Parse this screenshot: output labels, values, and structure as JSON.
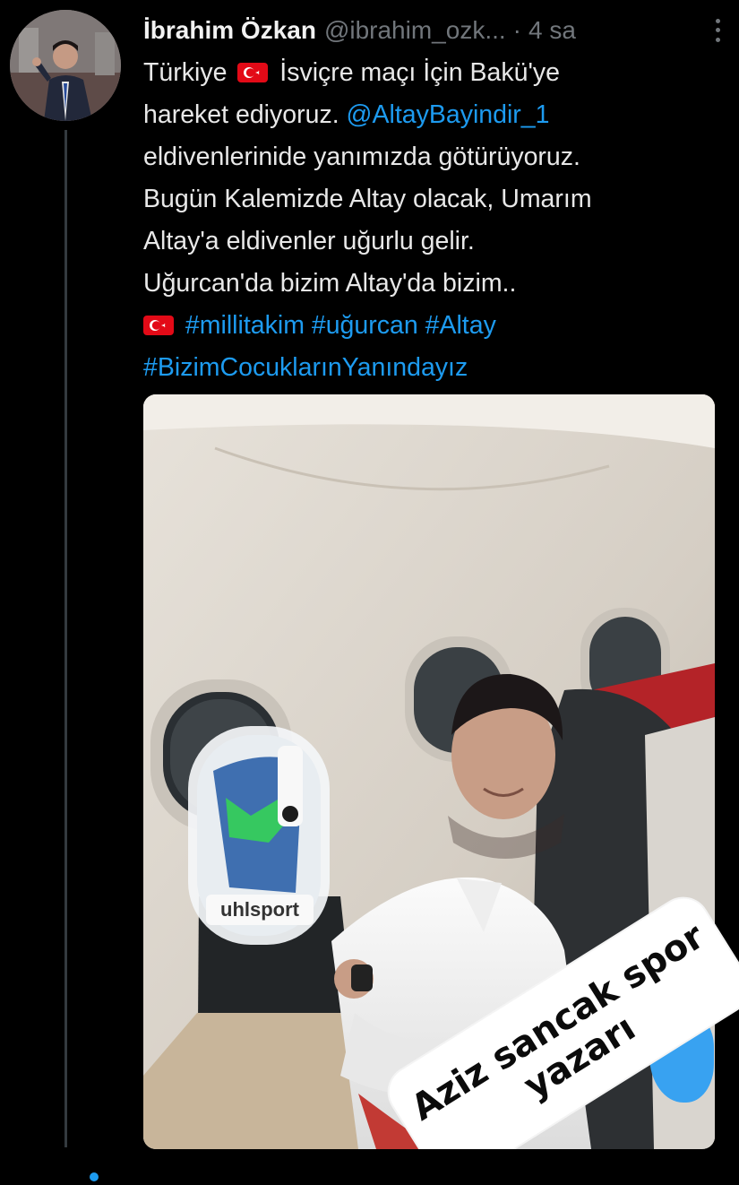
{
  "tweet": {
    "author_name": "İbrahim Özkan",
    "author_handle": "@ibrahim_ozk...",
    "separator": "·",
    "time": "4 sa",
    "lines": {
      "l1_a": "Türkiye",
      "l1_b": "İsviçre maçı İçin Bakü'ye",
      "l2_a": "hareket ediyoruz.",
      "l2_link": "@AltayBayindir_1",
      "l3": "eldivenlerinide yanımızda götürüyoruz.",
      "l4": "Bugün Kalemizde Altay olacak, Umarım",
      "l5": "Altay'a eldivenler uğurlu gelir.",
      "l6": "Uğurcan'da bizim Altay'da bizim..",
      "l7_tags": "#millitakim #uğurcan #Altay",
      "l8_tag": "#BizimCocuklarınYanındayız"
    },
    "media": {
      "bag_brand": "uhlsport"
    }
  },
  "sticker": {
    "line1": "Aziz sancak spor",
    "line2": "yazarı"
  },
  "colors": {
    "background": "#000000",
    "link": "#1d9bf0",
    "muted": "#71767b",
    "flag_red": "#e30a17"
  },
  "icons": [
    "more-options-icon",
    "turkish-flag-icon",
    "turkish-flag-icon"
  ]
}
